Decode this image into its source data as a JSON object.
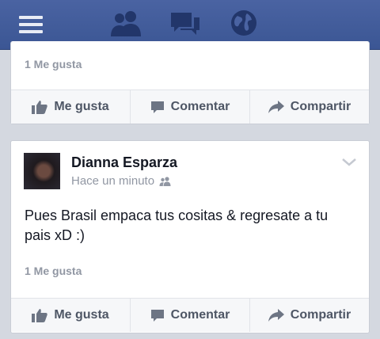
{
  "topbar": {
    "icons": [
      "menu-icon",
      "friends-icon",
      "messages-icon",
      "notifications-globe-icon"
    ],
    "bg_color": "#3b5694"
  },
  "post1": {
    "likes": "1 Me gusta",
    "actions": {
      "like": "Me gusta",
      "comment": "Comentar",
      "share": "Compartir"
    }
  },
  "post2": {
    "author": "Dianna Esparza",
    "time": "Hace un minuto",
    "privacy_icon": "friends-privacy-icon",
    "text": "Pues Brasil empaca tus cositas & regresate a tu pais xD :)",
    "likes": "1 Me gusta",
    "actions": {
      "like": "Me gusta",
      "comment": "Comentar",
      "share": "Compartir"
    }
  }
}
